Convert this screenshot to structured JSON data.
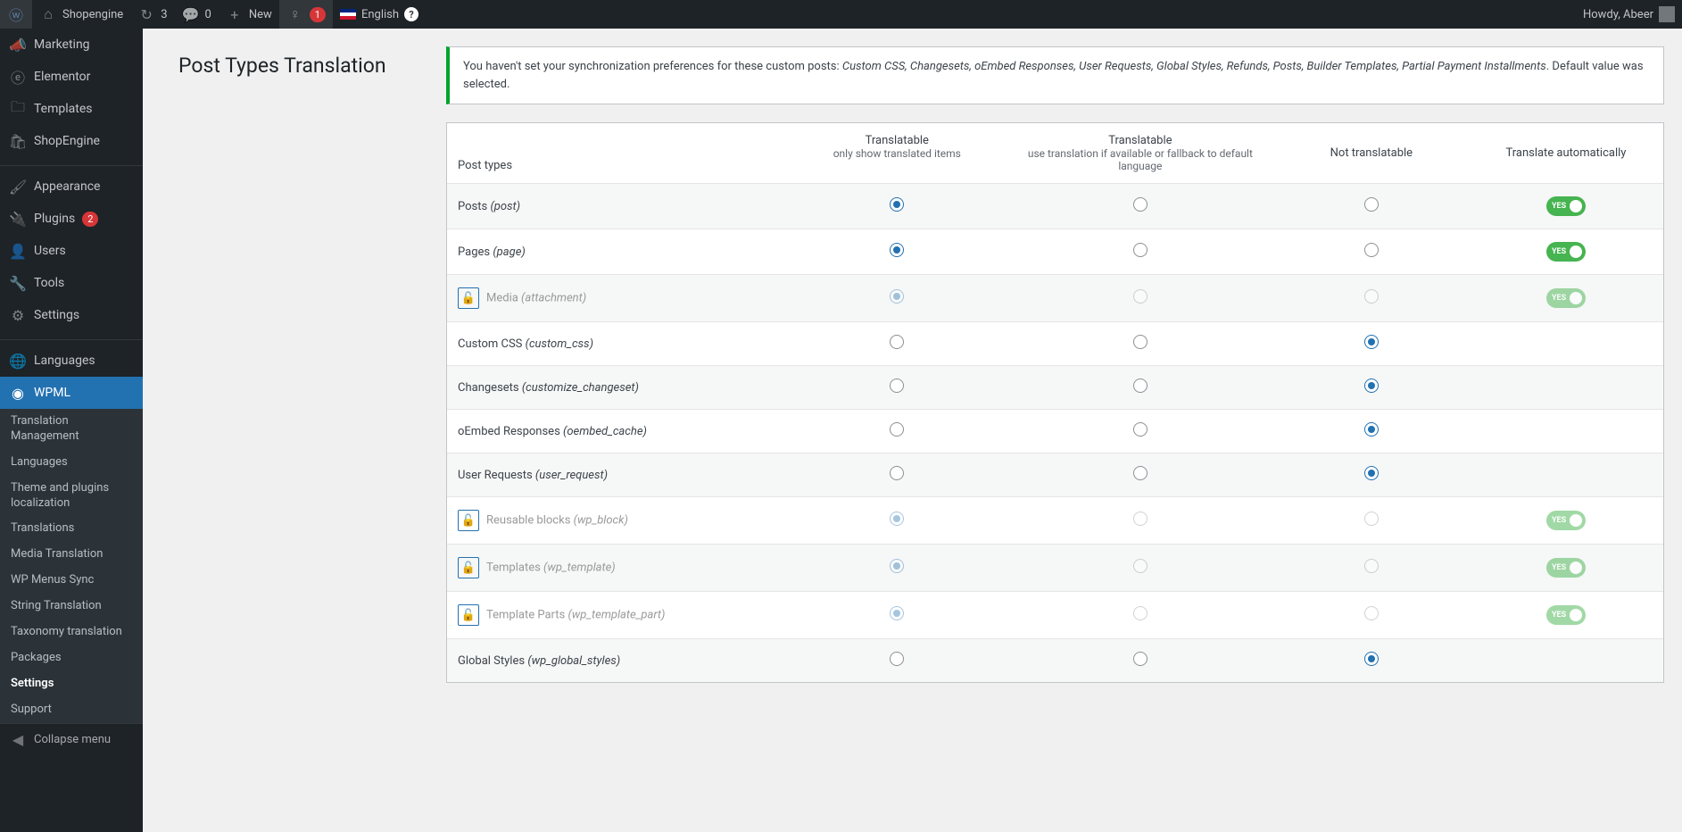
{
  "adminbar": {
    "site": "Shopengine",
    "updates": "3",
    "comments": "0",
    "new": "New",
    "notif": "1",
    "lang": "English",
    "howdy": "Howdy, Abeer"
  },
  "sidebar": {
    "marketing": "Marketing",
    "elementor": "Elementor",
    "templates": "Templates",
    "shopengine": "ShopEngine",
    "appearance": "Appearance",
    "plugins": "Plugins",
    "plugins_count": "2",
    "users": "Users",
    "tools": "Tools",
    "settings": "Settings",
    "languages": "Languages",
    "wpml": "WPML",
    "submenu": {
      "tm": "Translation Management",
      "langs": "Languages",
      "theme": "Theme and plugins localization",
      "translations": "Translations",
      "media": "Media Translation",
      "menus": "WP Menus Sync",
      "string": "String Translation",
      "taxonomy": "Taxonomy translation",
      "packages": "Packages",
      "settings": "Settings",
      "support": "Support"
    },
    "collapse": "Collapse menu"
  },
  "page": {
    "title": "Post Types Translation",
    "notice_pre": "You haven't set your synchronization preferences for these custom posts: ",
    "notice_items": "Custom CSS, Changesets, oEmbed Responses, User Requests, Global Styles, Refunds, Posts, Builder Templates, Partial Payment Installments",
    "notice_post": ". Default value was selected."
  },
  "table": {
    "h_posttypes": "Post types",
    "h_trans": "Translatable",
    "h_trans_sub": "only show translated items",
    "h_fallback": "Translatable",
    "h_fallback_sub": "use translation if available or fallback to default language",
    "h_not": "Not translatable",
    "h_auto": "Translate automatically",
    "yes": "YES",
    "rows": [
      {
        "label": "Posts",
        "slug": "post",
        "locked": false,
        "sel": 0,
        "auto": true
      },
      {
        "label": "Pages",
        "slug": "page",
        "locked": false,
        "sel": 0,
        "auto": true
      },
      {
        "label": "Media",
        "slug": "attachment",
        "locked": true,
        "sel": 0,
        "auto": true
      },
      {
        "label": "Custom CSS",
        "slug": "custom_css",
        "locked": false,
        "sel": 2,
        "auto": false
      },
      {
        "label": "Changesets",
        "slug": "customize_changeset",
        "locked": false,
        "sel": 2,
        "auto": false
      },
      {
        "label": "oEmbed Responses",
        "slug": "oembed_cache",
        "locked": false,
        "sel": 2,
        "auto": false
      },
      {
        "label": "User Requests",
        "slug": "user_request",
        "locked": false,
        "sel": 2,
        "auto": false
      },
      {
        "label": "Reusable blocks",
        "slug": "wp_block",
        "locked": true,
        "sel": 0,
        "auto": true
      },
      {
        "label": "Templates",
        "slug": "wp_template",
        "locked": true,
        "sel": 0,
        "auto": true
      },
      {
        "label": "Template Parts",
        "slug": "wp_template_part",
        "locked": true,
        "sel": 0,
        "auto": true
      },
      {
        "label": "Global Styles",
        "slug": "wp_global_styles",
        "locked": false,
        "sel": 2,
        "auto": false
      }
    ]
  }
}
